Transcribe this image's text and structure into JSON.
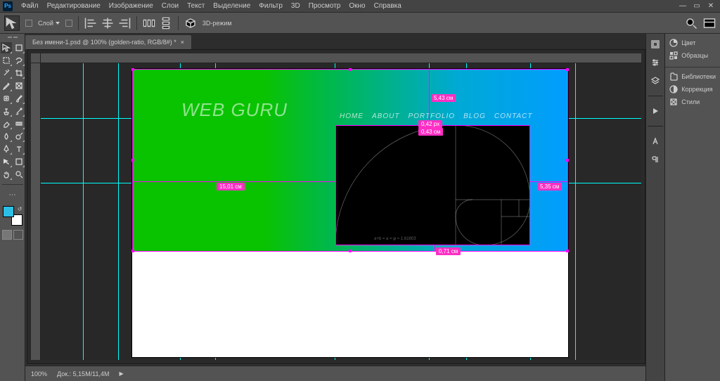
{
  "app_logo": "Ps",
  "menu": [
    "Файл",
    "Редактирование",
    "Изображение",
    "Слои",
    "Текст",
    "Выделение",
    "Фильтр",
    "3D",
    "Просмотр",
    "Окно",
    "Справка"
  ],
  "optbar": {
    "layer_label": "Слой",
    "mode_label": "3D-режим"
  },
  "doc_tab": "Без имени-1.psd @ 100% (golden-ratio, RGB/8#) *",
  "canvas": {
    "logo": "WEB GURU",
    "nav": [
      "HOME",
      "ABOUT",
      "PORTFOLIO",
      "BLOG",
      "CONTACT"
    ],
    "formula": "a+b   =   a   =  φ ≈ 1.61803",
    "measurements": {
      "top": "5,43 см",
      "w": "0,42 px",
      "h_small": "0,43 см",
      "left": "15,01 см",
      "right": "5,35 см",
      "bottom": "0,71 см"
    }
  },
  "right_panels": [
    "Цвет",
    "Образцы",
    "Библиотеки",
    "Коррекция",
    "Стили"
  ],
  "status": {
    "zoom": "100%",
    "doc_info": "Док.: 5,15M/11,4M"
  },
  "colors": {
    "fg": "#2bbfe6",
    "bg": "#ffffff",
    "guide": "#00ffff",
    "selection": "#ff00ff",
    "measurement": "#ff2ec4"
  }
}
